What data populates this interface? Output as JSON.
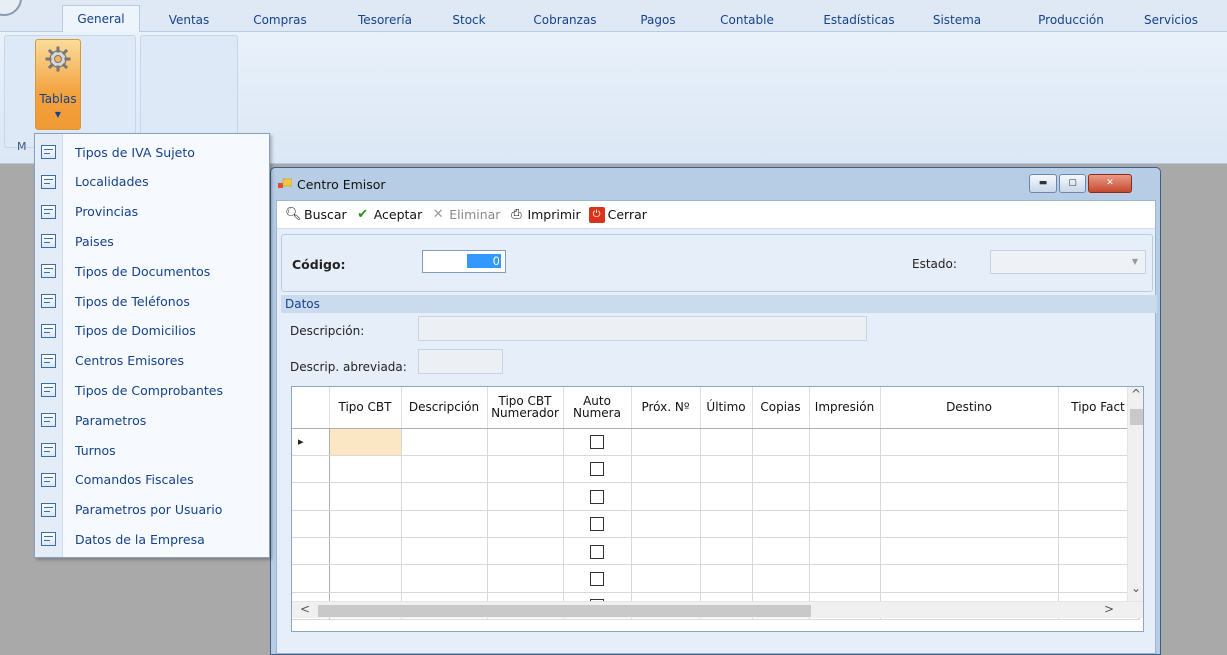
{
  "ribbon": {
    "tabs": [
      "General",
      "Ventas",
      "Compras",
      "Tesorería",
      "Stock",
      "Cobranzas",
      "Pagos",
      "Contable",
      "Estadísticas",
      "Sistema",
      "Producción",
      "Servicios"
    ],
    "active_tab": "General",
    "tablas_label": "Tablas",
    "group_label": "M"
  },
  "menu": {
    "items": [
      "Tipos de IVA Sujeto",
      "Localidades",
      "Provincias",
      "Paises",
      "Tipos de Documentos",
      "Tipos de Teléfonos",
      "Tipos de Domicilios",
      "Centros Emisores",
      "Tipos de Comprobantes",
      "Parametros",
      "Turnos",
      "Comandos Fiscales",
      "Parametros por Usuario",
      "Datos de la Empresa"
    ]
  },
  "window": {
    "title": "Centro Emisor",
    "toolbar": {
      "buscar": "Buscar",
      "aceptar": "Aceptar",
      "eliminar": "Eliminar",
      "imprimir": "Imprimir",
      "cerrar": "Cerrar"
    },
    "codigo_label": "Código:",
    "codigo_value": "0",
    "estado_label": "Estado:",
    "estado_value": "",
    "datos_label": "Datos",
    "descripcion_label": "Descripción:",
    "descripcion_value": "",
    "descrip_abrev_label": "Descrip. abreviada:",
    "descrip_abrev_value": ""
  },
  "grid": {
    "columns": [
      "Tipo CBT",
      "Descripción",
      "Tipo CBT Numerador",
      "Auto Numera",
      "Próx. Nº",
      "Último",
      "Copias",
      "Impresión",
      "Destino",
      "Tipo Fact"
    ],
    "column_lines": [
      [
        "Tipo CBT"
      ],
      [
        "Descripción"
      ],
      [
        "Tipo CBT",
        "Numerador"
      ],
      [
        "Auto",
        "Numera"
      ],
      [
        "Próx. Nº"
      ],
      [
        "Último"
      ],
      [
        "Copias"
      ],
      [
        "Impresión"
      ],
      [
        "Destino"
      ],
      [
        "Tipo Fact"
      ]
    ],
    "row_count": 7
  }
}
